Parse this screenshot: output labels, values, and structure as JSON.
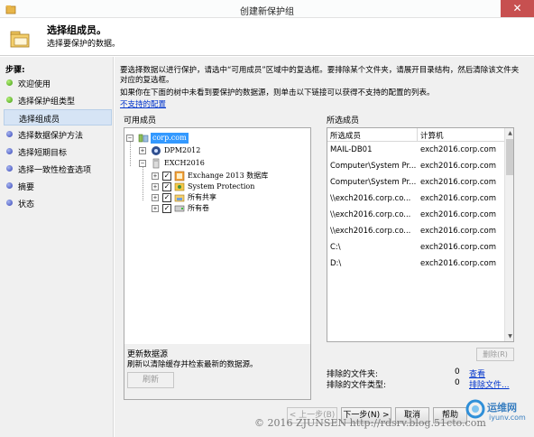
{
  "window": {
    "title": "创建新保护组",
    "close_glyph": "✕"
  },
  "header": {
    "title": "选择组成员。",
    "subtitle": "选择要保护的数据。"
  },
  "sidebar": {
    "label": "步骤:",
    "steps": [
      {
        "label": "欢迎使用",
        "state": "done"
      },
      {
        "label": "选择保护组类型",
        "state": "done"
      },
      {
        "label": "选择组成员",
        "state": "active"
      },
      {
        "label": "选择数据保护方法",
        "state": "todo"
      },
      {
        "label": "选择短期目标",
        "state": "todo"
      },
      {
        "label": "选择一致性检查选项",
        "state": "todo"
      },
      {
        "label": "摘要",
        "state": "todo"
      },
      {
        "label": "状态",
        "state": "todo"
      }
    ]
  },
  "main": {
    "desc1": "要选择数据以进行保护，请选中“可用成员”区域中的复选框。要排除某个文件夹，请展开目录结构，然后清除该文件夹对应的复选框。",
    "desc2": "如果你在下面的树中未看到要保护的数据源，则单击以下链接可以获得不支持的配置的列表。",
    "unsupported_link": "不支持的配置",
    "available_label": "可用成员",
    "selected_label": "所选成员",
    "tree": {
      "root": "corp.com",
      "dpm": "DPM2012",
      "exch": "EXCH2016",
      "children": [
        "Exchange 2013 数据库",
        "System Protection",
        "所有共享",
        "所有卷"
      ]
    },
    "refresh": {
      "title": "更新数据源",
      "desc": "刷新以清除缓存并检索最新的数据源。",
      "button": "刷新"
    },
    "selected_table": {
      "headers": [
        "所选成员",
        "计算机"
      ],
      "rows": [
        [
          "MAIL-DB01",
          "exch2016.corp.com"
        ],
        [
          "Computer\\System Pr...",
          "exch2016.corp.com"
        ],
        [
          "Computer\\System Pr...",
          "exch2016.corp.com"
        ],
        [
          "\\\\exch2016.corp.co...",
          "exch2016.corp.com"
        ],
        [
          "\\\\exch2016.corp.co...",
          "exch2016.corp.com"
        ],
        [
          "\\\\exch2016.corp.co...",
          "exch2016.corp.com"
        ],
        [
          "C:\\",
          "exch2016.corp.com"
        ],
        [
          "D:\\",
          "exch2016.corp.com"
        ]
      ]
    },
    "remove_button": "删除(R)",
    "excluded_folders_label": "排除的文件夹:",
    "excluded_folders_count": "0",
    "excluded_folders_link": "查看",
    "excluded_types_label": "排除的文件类型:",
    "excluded_types_count": "0",
    "excluded_types_link": "排除文件..."
  },
  "footer": {
    "back": "< 上一步(B)",
    "next": "下一步(N) >",
    "cancel": "取消",
    "help": "帮助"
  },
  "watermark": {
    "text": "© 2016 ZJUNSEN http://rdsrv.blog.51cto.com",
    "logo_text": "运维网",
    "logo_sub": "iyunv.com"
  }
}
